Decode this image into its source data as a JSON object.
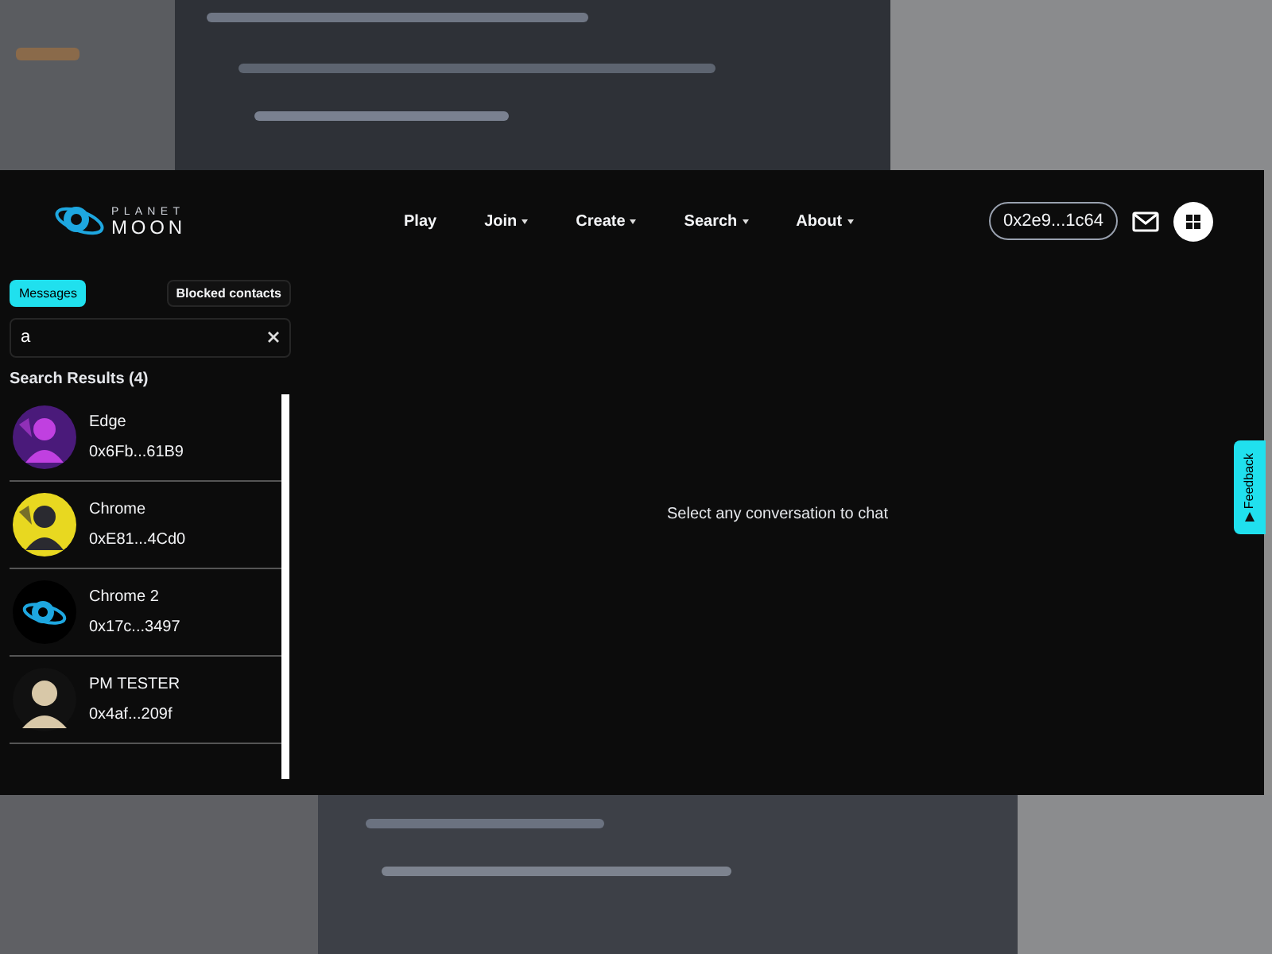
{
  "logo": {
    "top": "PLANET",
    "bottom": "MOON"
  },
  "nav": [
    {
      "label": "Play",
      "dropdown": false
    },
    {
      "label": "Join",
      "dropdown": true
    },
    {
      "label": "Create",
      "dropdown": true
    },
    {
      "label": "Search",
      "dropdown": true
    },
    {
      "label": "About",
      "dropdown": true
    }
  ],
  "wallet": "0x2e9...1c64",
  "tabs": [
    {
      "label": "Messages",
      "selected": true
    },
    {
      "label": "Blocked contacts",
      "selected": false
    }
  ],
  "search": {
    "value": "a"
  },
  "results_title": "Search Results (4)",
  "contacts": [
    {
      "name": "Edge",
      "address": "0x6Fb...61B9",
      "kind": "picture"
    },
    {
      "name": "Chrome",
      "address": "0xE81...4Cd0",
      "kind": "picture"
    },
    {
      "name": "Chrome 2",
      "address": "0x17c...3497",
      "kind": "logo"
    },
    {
      "name": "PM TESTER",
      "address": "0x4af...209f",
      "kind": "figure"
    }
  ],
  "empty_state": "Select any conversation to chat",
  "feedback": "Feedback"
}
